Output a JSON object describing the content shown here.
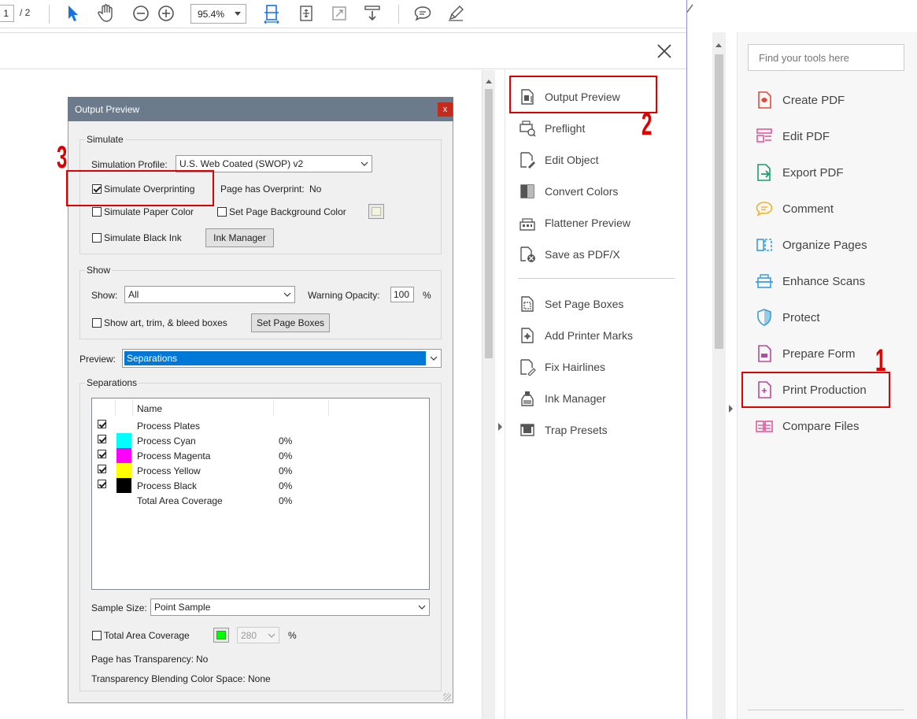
{
  "toolbar": {
    "page_current": "1",
    "page_total": "/ 2",
    "zoom": "95.4%"
  },
  "dialog": {
    "title": "Output Preview",
    "close_label": "x",
    "simulate": {
      "group_label": "Simulate",
      "profile_label": "Simulation Profile:",
      "profile_value": "U.S. Web Coated (SWOP) v2",
      "overprint_label": "Simulate Overprinting",
      "overprint_status_label": "Page has Overprint:",
      "overprint_status_value": "No",
      "paper_color_label": "Simulate Paper Color",
      "page_bg_label": "Set Page Background Color",
      "black_ink_label": "Simulate Black Ink",
      "ink_manager_label": "Ink Manager"
    },
    "show": {
      "group_label": "Show",
      "show_label": "Show:",
      "show_value": "All",
      "warning_label": "Warning Opacity:",
      "warning_value": "100",
      "warning_unit": "%",
      "boxes_label": "Show art, trim, & bleed boxes",
      "set_boxes_label": "Set Page Boxes"
    },
    "preview_label": "Preview:",
    "preview_value": "Separations",
    "separations": {
      "group_label": "Separations",
      "col_name": "Name",
      "rows": [
        {
          "name": "Process Plates",
          "value": "",
          "color": "",
          "checked": true
        },
        {
          "name": "Process Cyan",
          "value": "0%",
          "color": "#00ffff",
          "checked": true
        },
        {
          "name": "Process Magenta",
          "value": "0%",
          "color": "#ff00ff",
          "checked": true
        },
        {
          "name": "Process Yellow",
          "value": "0%",
          "color": "#ffff00",
          "checked": true
        },
        {
          "name": "Process Black",
          "value": "0%",
          "color": "#000000",
          "checked": true
        },
        {
          "name": "Total Area Coverage",
          "value": "0%",
          "color": "",
          "checked": false
        }
      ]
    },
    "sample_size_label": "Sample Size:",
    "sample_size_value": "Point Sample",
    "tac_label": "Total Area Coverage",
    "tac_value": "280",
    "tac_unit": "%",
    "transparency_label": "Page has Transparency:",
    "transparency_value": "No",
    "blending_label": "Transparency Blending Color Space:",
    "blending_value": "None"
  },
  "print_menu": {
    "items": [
      {
        "label": "Output Preview"
      },
      {
        "label": "Preflight"
      },
      {
        "label": "Edit Object"
      },
      {
        "label": "Convert Colors"
      },
      {
        "label": "Flattener Preview"
      },
      {
        "label": "Save as PDF/X"
      },
      {
        "label": "Set Page Boxes"
      },
      {
        "label": "Add Printer Marks"
      },
      {
        "label": "Fix Hairlines"
      },
      {
        "label": "Ink Manager"
      },
      {
        "label": "Trap Presets"
      }
    ]
  },
  "tools_pane": {
    "search_placeholder": "Find your tools here",
    "items": [
      {
        "label": "Create PDF"
      },
      {
        "label": "Edit PDF"
      },
      {
        "label": "Export PDF"
      },
      {
        "label": "Comment"
      },
      {
        "label": "Organize Pages"
      },
      {
        "label": "Enhance Scans"
      },
      {
        "label": "Protect"
      },
      {
        "label": "Prepare Form"
      },
      {
        "label": "Print Production"
      },
      {
        "label": "Compare Files"
      }
    ]
  },
  "annotations": {
    "num1": "1",
    "num2": "2",
    "num3": "3"
  },
  "colors": {
    "accent_red": "#e00000",
    "dialog_title_bg": "#6b7b8c",
    "selection_blue": "#0078d7",
    "tac_swatch": "#00ff00"
  }
}
